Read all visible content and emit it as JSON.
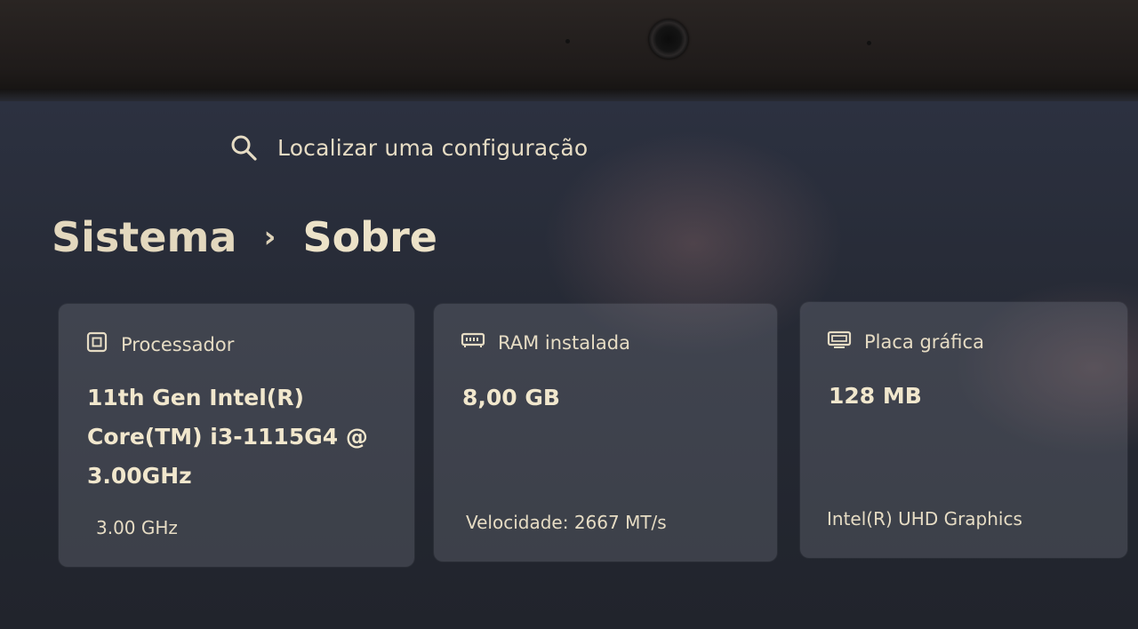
{
  "search": {
    "placeholder": "Localizar uma configuração",
    "icon": "search-icon"
  },
  "breadcrumb": {
    "parent": "Sistema",
    "separator": "›",
    "current": "Sobre"
  },
  "cards": [
    {
      "icon": "processor-icon",
      "title": "Processador",
      "value_lines": [
        "11th Gen Intel(R)",
        "Core(TM) i3-1115G4 @",
        "3.00GHz"
      ],
      "footer": "3.00 GHz"
    },
    {
      "icon": "memory-icon",
      "title": "RAM instalada",
      "value_lines": [
        "8,00 GB"
      ],
      "footer": "Velocidade: 2667 MT/s"
    },
    {
      "icon": "display-adapter-icon",
      "title": "Placa gráfica",
      "value_lines": [
        "128 MB"
      ],
      "footer": "Intel(R) UHD Graphics"
    }
  ],
  "colors": {
    "text": "#e6dcc4",
    "card_background": "#5a5e6a",
    "screen_background": "#2a2e3a"
  }
}
